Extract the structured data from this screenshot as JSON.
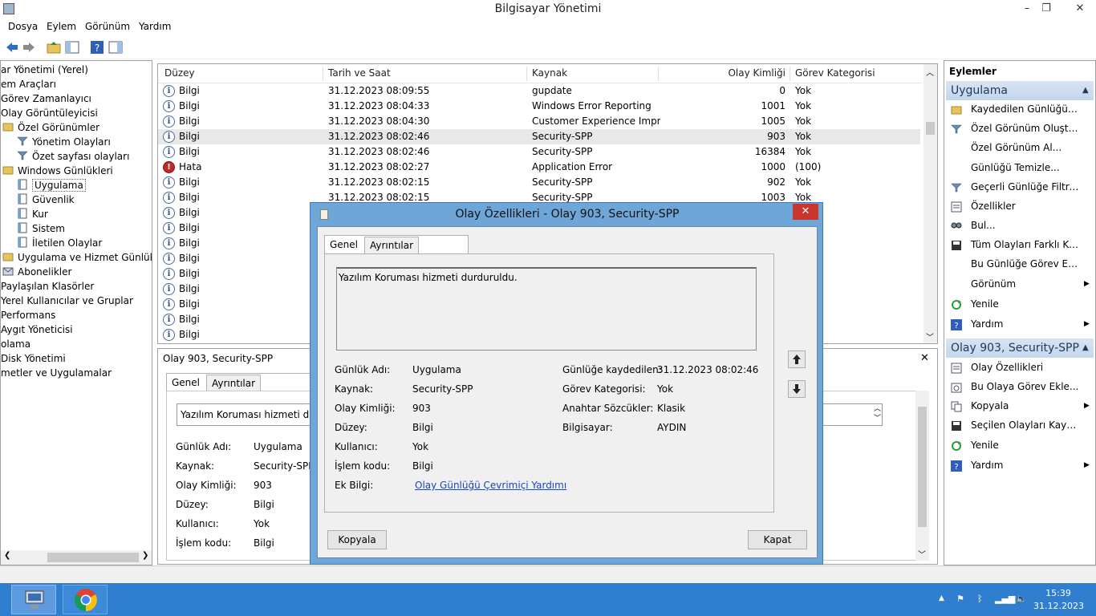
{
  "window": {
    "title": "Bilgisayar Yönetimi",
    "minimize": "–",
    "maximize": "❐",
    "close": "✕"
  },
  "menu": [
    "Dosya",
    "Eylem",
    "Görünüm",
    "Yardım"
  ],
  "tree": [
    {
      "label": "ar Yönetimi (Yerel)",
      "indent": 0
    },
    {
      "label": "em Araçları",
      "indent": 0
    },
    {
      "label": "Görev Zamanlayıcı",
      "indent": 0
    },
    {
      "label": "Olay Görüntüleyicisi",
      "indent": 0
    },
    {
      "label": "Özel Görünümler",
      "indent": 1,
      "icon": "folder-icon"
    },
    {
      "label": "Yönetim Olayları",
      "indent": 2,
      "icon": "filter-icon"
    },
    {
      "label": "Özet sayfası olayları",
      "indent": 2,
      "icon": "filter-icon"
    },
    {
      "label": "Windows Günlükleri",
      "indent": 1,
      "icon": "folder-icon"
    },
    {
      "label": "Uygulama",
      "indent": 2,
      "icon": "log-icon",
      "selected": true
    },
    {
      "label": "Güvenlik",
      "indent": 2,
      "icon": "log-icon"
    },
    {
      "label": "Kur",
      "indent": 2,
      "icon": "log-icon"
    },
    {
      "label": "Sistem",
      "indent": 2,
      "icon": "log-icon"
    },
    {
      "label": "İletilen Olaylar",
      "indent": 2,
      "icon": "log-icon"
    },
    {
      "label": "Uygulama ve Hizmet Günlükleri",
      "indent": 1,
      "icon": "folder-icon"
    },
    {
      "label": "Abonelikler",
      "indent": 1,
      "icon": "subscription-icon"
    },
    {
      "label": "Paylaşılan Klasörler",
      "indent": 0
    },
    {
      "label": "Yerel Kullanıcılar ve Gruplar",
      "indent": 0
    },
    {
      "label": "Performans",
      "indent": 0
    },
    {
      "label": "Aygıt Yöneticisi",
      "indent": 0
    },
    {
      "label": "olama",
      "indent": 0
    },
    {
      "label": "Disk Yönetimi",
      "indent": 0
    },
    {
      "label": "metler ve Uygulamalar",
      "indent": 0
    }
  ],
  "list": {
    "columns": [
      "Düzey",
      "Tarih ve Saat",
      "Kaynak",
      "Olay Kimliği",
      "Görev Kategorisi"
    ],
    "rows": [
      {
        "level": "Bilgi",
        "type": "info",
        "date": "31.12.2023 08:09:55",
        "source": "gupdate",
        "id": "0",
        "cat": "Yok"
      },
      {
        "level": "Bilgi",
        "type": "info",
        "date": "31.12.2023 08:04:33",
        "source": "Windows Error Reporting",
        "id": "1001",
        "cat": "Yok"
      },
      {
        "level": "Bilgi",
        "type": "info",
        "date": "31.12.2023 08:04:30",
        "source": "Customer Experience Impr...",
        "id": "1005",
        "cat": "Yok"
      },
      {
        "level": "Bilgi",
        "type": "info",
        "date": "31.12.2023 08:02:46",
        "source": "Security-SPP",
        "id": "903",
        "cat": "Yok",
        "selected": true
      },
      {
        "level": "Bilgi",
        "type": "info",
        "date": "31.12.2023 08:02:46",
        "source": "Security-SPP",
        "id": "16384",
        "cat": "Yok"
      },
      {
        "level": "Hata",
        "type": "error",
        "date": "31.12.2023 08:02:27",
        "source": "Application Error",
        "id": "1000",
        "cat": "(100)"
      },
      {
        "level": "Bilgi",
        "type": "info",
        "date": "31.12.2023 08:02:15",
        "source": "Security-SPP",
        "id": "902",
        "cat": "Yok"
      },
      {
        "level": "Bilgi",
        "type": "info",
        "date": "31.12.2023 08:02:15",
        "source": "Security-SPP",
        "id": "1003",
        "cat": "Yok"
      },
      {
        "level": "Bilgi",
        "type": "info",
        "date": "",
        "source": "",
        "id": "",
        "cat": ""
      },
      {
        "level": "Bilgi",
        "type": "info",
        "date": "",
        "source": "",
        "id": "",
        "cat": ""
      },
      {
        "level": "Bilgi",
        "type": "info",
        "date": "",
        "source": "",
        "id": "",
        "cat": ""
      },
      {
        "level": "Bilgi",
        "type": "info",
        "date": "",
        "source": "",
        "id": "",
        "cat": ""
      },
      {
        "level": "Bilgi",
        "type": "info",
        "date": "",
        "source": "",
        "id": "",
        "cat": ""
      },
      {
        "level": "Bilgi",
        "type": "info",
        "date": "",
        "source": "",
        "id": "",
        "cat": ""
      },
      {
        "level": "Bilgi",
        "type": "info",
        "date": "",
        "source": "",
        "id": "",
        "cat": ""
      },
      {
        "level": "Bilgi",
        "type": "info",
        "date": "",
        "source": "",
        "id": "",
        "cat": ""
      },
      {
        "level": "Bilgi",
        "type": "info",
        "date": "",
        "source": "",
        "id": "",
        "cat": ""
      }
    ]
  },
  "preview": {
    "header": "Olay 903, Security-SPP",
    "close": "✕",
    "tabs": [
      "Genel",
      "Ayrıntılar"
    ],
    "message": "Yazılım Koruması hizmeti durdu",
    "fields": [
      {
        "label": "Günlük Adı:",
        "value": "Uygulama"
      },
      {
        "label": "Kaynak:",
        "value": "Security-SPP"
      },
      {
        "label": "Olay Kimliği:",
        "value": "903"
      },
      {
        "label": "Düzey:",
        "value": "Bilgi"
      },
      {
        "label": "Kullanıcı:",
        "value": "Yok"
      },
      {
        "label": "İşlem kodu:",
        "value": "Bilgi"
      }
    ]
  },
  "actions": {
    "title": "Eylemler",
    "section1": "Uygulama",
    "items1": [
      {
        "label": "Kaydedilen Günlüğü A...",
        "icon": "open-folder-icon"
      },
      {
        "label": "Özel Görünüm Oluştur...",
        "icon": "filter-icon"
      },
      {
        "label": "Özel Görünüm Al...",
        "icon": ""
      },
      {
        "label": "Günlüğü Temizle...",
        "icon": ""
      },
      {
        "label": "Geçerli Günlüğe Filtre ...",
        "icon": "filter-icon"
      },
      {
        "label": "Özellikler",
        "icon": "properties-icon"
      },
      {
        "label": "Bul...",
        "icon": "find-icon"
      },
      {
        "label": "Tüm Olayları Farklı Kay...",
        "icon": "save-icon"
      },
      {
        "label": "Bu Günlüğe Görev Ekle...",
        "icon": ""
      },
      {
        "label": "Görünüm",
        "icon": "",
        "submenu": true
      },
      {
        "label": "Yenile",
        "icon": "refresh-icon"
      },
      {
        "label": "Yardım",
        "icon": "help-icon",
        "submenu": true
      }
    ],
    "section2": "Olay 903, Security-SPP",
    "items2": [
      {
        "label": "Olay Özellikleri",
        "icon": "properties-icon"
      },
      {
        "label": "Bu Olaya Görev Ekle...",
        "icon": "task-icon"
      },
      {
        "label": "Kopyala",
        "icon": "copy-icon",
        "submenu": true
      },
      {
        "label": "Seçilen Olayları Kaydet...",
        "icon": "save-icon"
      },
      {
        "label": "Yenile",
        "icon": "refresh-icon"
      },
      {
        "label": "Yardım",
        "icon": "help-icon",
        "submenu": true
      }
    ]
  },
  "dialog": {
    "title": "Olay Özellikleri - Olay 903, Security-SPP",
    "close": "✕",
    "tabs": [
      "Genel",
      "Ayrıntılar"
    ],
    "message": "Yazılım Koruması hizmeti durduruldu.",
    "left_fields": [
      {
        "label": "Günlük Adı:",
        "value": "Uygulama"
      },
      {
        "label": "Kaynak:",
        "value": "Security-SPP"
      },
      {
        "label": "Olay Kimliği:",
        "value": "903"
      },
      {
        "label": "Düzey:",
        "value": "Bilgi"
      },
      {
        "label": "Kullanıcı:",
        "value": "Yok"
      },
      {
        "label": "İşlem kodu:",
        "value": "Bilgi"
      }
    ],
    "extra_label": "Ek Bilgi:",
    "extra_link": "Olay Günlüğü Çevrimiçi Yardımı",
    "right_fields": [
      {
        "label": "Günlüğe kaydedilen:",
        "value": "31.12.2023 08:02:46"
      },
      {
        "label": "Görev Kategorisi:",
        "value": "Yok"
      },
      {
        "label": "Anahtar Sözcükler:",
        "value": "Klasik"
      },
      {
        "label": "Bilgisayar:",
        "value": "AYDIN"
      }
    ],
    "copy_button": "Kopyala",
    "close_button": "Kapat"
  },
  "taskbar": {
    "time": "15:39",
    "date": "31.12.2023"
  },
  "colors": {
    "taskbar": "#2f7ed0",
    "dialog_frame": "#6fa6d8",
    "close_red": "#c7352c",
    "section_header": "#c4d6ec",
    "selected_row": "#e8e8e8"
  }
}
